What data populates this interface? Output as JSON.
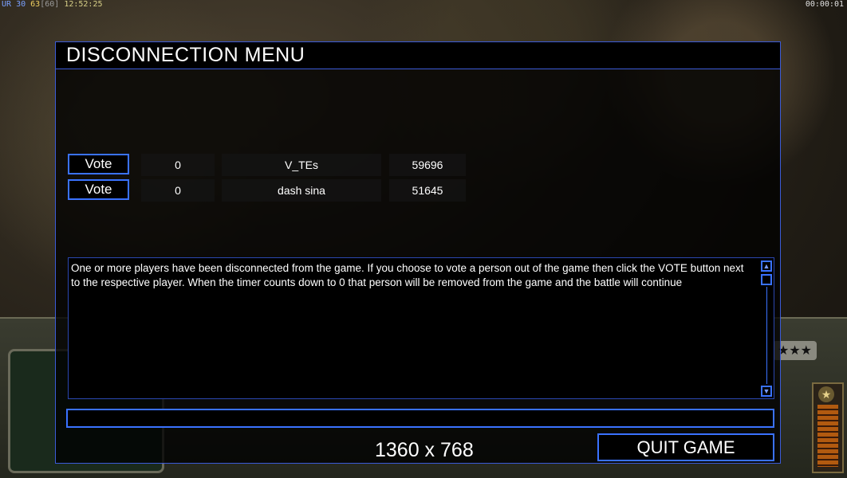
{
  "overlay": {
    "stats_ur": "UR",
    "stats_fps": "30",
    "stats_logic": "63",
    "stats_limit": "[60]",
    "clock": "12:52:25",
    "game_timer": "00:00:01"
  },
  "hud": {
    "stars": "★★★",
    "rank_icon": "★"
  },
  "dialog": {
    "title": "DISCONNECTION MENU",
    "players": [
      {
        "vote_label": "Vote",
        "votes": "0",
        "name": "V_TEs",
        "timer": "59696"
      },
      {
        "vote_label": "Vote",
        "votes": "0",
        "name": "dash sina",
        "timer": "51645"
      }
    ],
    "message": "One or more players have been disconnected from the game. If you choose to vote a person out of the game then click the VOTE button next to the respective player. When the timer counts down to 0 that person will be removed from the game and the battle will continue",
    "chat_value": "",
    "resolution": "1360 x 768",
    "quit_label": "QUIT GAME"
  },
  "colors": {
    "accent": "#3a72ff",
    "text": "#ffffff",
    "panel": "#000000"
  }
}
